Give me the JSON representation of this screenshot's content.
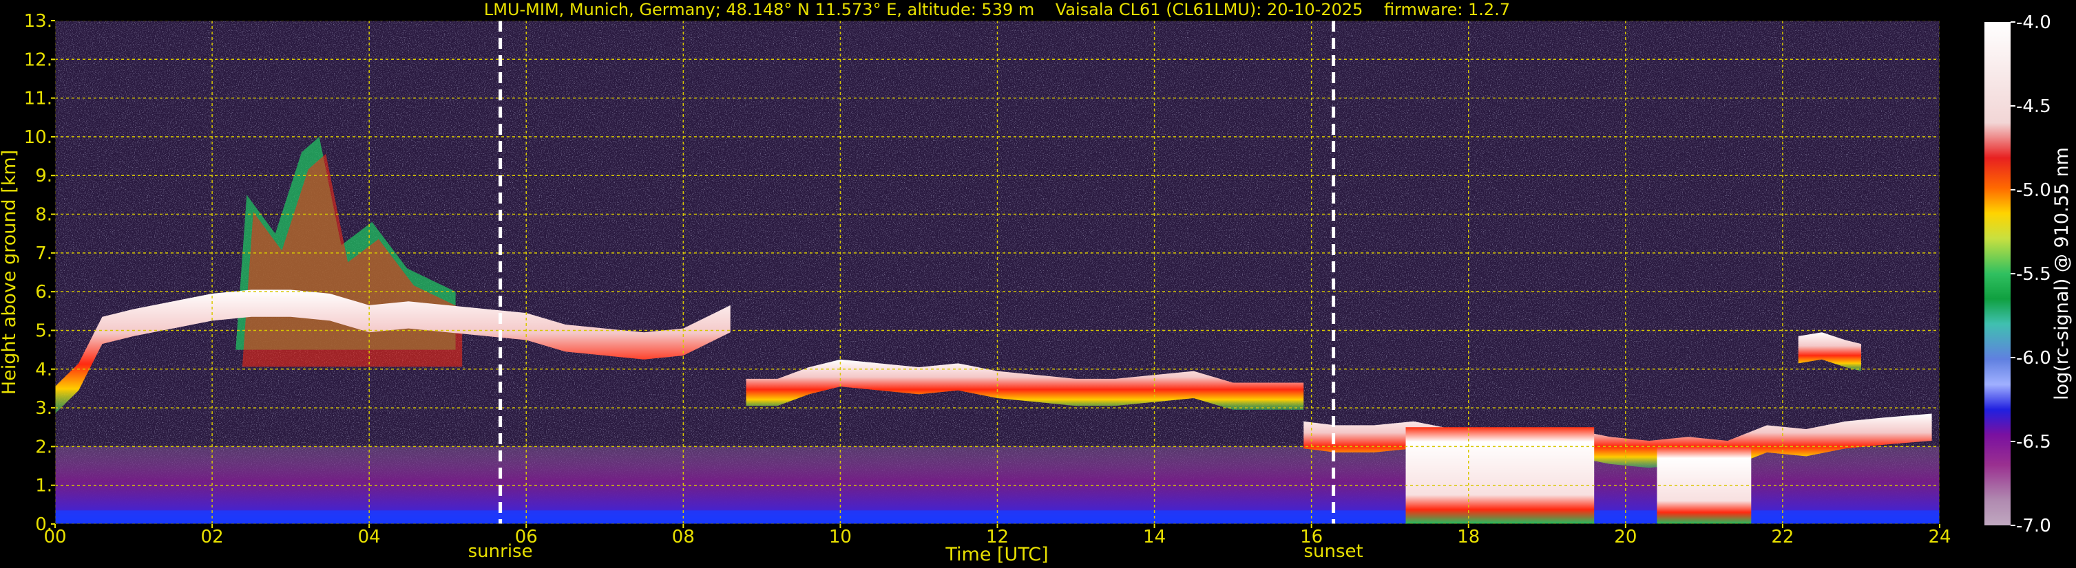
{
  "chart_data": {
    "type": "heatmap",
    "title": "LMU-MIM, Munich, Germany; 48.148° N 11.573° E, altitude: 539 m    Vaisala CL61 (CL61LMU): 20-10-2025    firmware: 1.2.7",
    "xlabel": "Time [UTC]",
    "ylabel": "Height above ground [km]",
    "colorbar_label": "log(rc-signal) @ 910.55 nm",
    "xlim": [
      0,
      24
    ],
    "ylim": [
      0,
      13
    ],
    "x_ticks": [
      "00",
      "02",
      "04",
      "06",
      "08",
      "10",
      "12",
      "14",
      "16",
      "18",
      "20",
      "22",
      "24"
    ],
    "x_tick_values": [
      0,
      2,
      4,
      6,
      8,
      10,
      12,
      14,
      16,
      18,
      20,
      22,
      24
    ],
    "y_ticks": [
      "0.",
      "1.",
      "2.",
      "3.",
      "4.",
      "5.",
      "6.",
      "7.",
      "8.",
      "9.",
      "10.",
      "11.",
      "12.",
      "13."
    ],
    "y_tick_values": [
      0,
      1,
      2,
      3,
      4,
      5,
      6,
      7,
      8,
      9,
      10,
      11,
      12,
      13
    ],
    "colorbar_ticks": [
      "-4.0",
      "-4.5",
      "-5.0",
      "-5.5",
      "-6.0",
      "-6.5",
      "-7.0"
    ],
    "colorbar_tick_values": [
      -4.0,
      -4.5,
      -5.0,
      -5.5,
      -6.0,
      -6.5,
      -7.0
    ],
    "colorbar_range": [
      -7.0,
      -4.0
    ],
    "grid": true,
    "markers": [
      {
        "label": "sunrise",
        "time": 5.67
      },
      {
        "label": "sunset",
        "time": 16.28
      }
    ],
    "cloud_layers": [
      {
        "t": [
          0.0,
          0.3,
          0.6,
          1.0,
          1.5,
          2.0,
          2.5,
          3.0,
          3.5,
          4.0,
          4.5,
          5.0,
          5.5,
          6.0,
          6.5,
          7.0,
          7.5,
          8.0,
          8.6
        ],
        "h": [
          3.4,
          4.0,
          5.2,
          5.4,
          5.6,
          5.8,
          5.9,
          5.9,
          5.8,
          5.5,
          5.6,
          5.5,
          5.4,
          5.3,
          5.0,
          4.9,
          4.8,
          4.9,
          5.5
        ]
      },
      {
        "t": [
          8.8,
          9.2,
          9.6,
          10.0,
          10.5,
          11.0,
          11.5,
          12.0,
          12.5,
          13.0,
          13.5,
          14.0,
          14.5,
          15.0,
          15.5,
          15.9
        ],
        "h": [
          3.6,
          3.6,
          3.9,
          4.1,
          4.0,
          3.9,
          4.0,
          3.8,
          3.7,
          3.6,
          3.6,
          3.7,
          3.8,
          3.5,
          3.5,
          3.5
        ]
      },
      {
        "t": [
          15.9,
          16.3,
          16.8,
          17.3,
          17.8,
          18.3,
          18.8,
          19.3,
          19.8,
          20.3,
          20.8,
          21.3,
          21.8,
          22.3,
          22.8,
          23.3,
          23.9
        ],
        "h": [
          2.5,
          2.4,
          2.4,
          2.5,
          2.3,
          2.1,
          2.2,
          2.3,
          2.1,
          2.0,
          2.1,
          2.0,
          2.4,
          2.3,
          2.5,
          2.6,
          2.7
        ]
      },
      {
        "t": [
          22.2,
          22.5,
          22.8,
          23.0
        ],
        "h": [
          4.7,
          4.8,
          4.6,
          4.5
        ]
      }
    ],
    "cirrus_regions": [
      {
        "t_start": 2.3,
        "t_end": 5.1,
        "h_base": 4.5,
        "h_top": 10.0
      }
    ],
    "precipitation_regions": [
      {
        "t_start": 17.2,
        "t_end": 19.6,
        "h_base": 0.0,
        "h_top": 2.5
      },
      {
        "t_start": 20.4,
        "t_end": 21.6,
        "h_base": 0.0,
        "h_top": 2.0
      }
    ]
  }
}
